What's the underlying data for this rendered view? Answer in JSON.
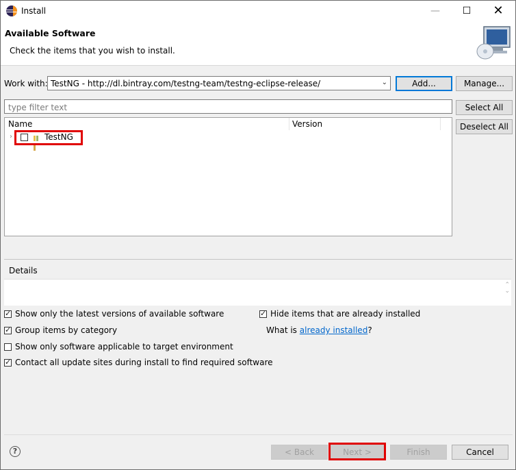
{
  "window": {
    "title": "Install",
    "minimize": "—",
    "maximize": "☐",
    "close": "✕"
  },
  "header": {
    "title": "Available Software",
    "subtitle": "Check the items that you wish to install."
  },
  "work_with": {
    "label": "Work with:",
    "value": "TestNG - http://dl.bintray.com/testng-team/testng-eclipse-release/",
    "add_label": "Add...",
    "manage_label": "Manage..."
  },
  "filter": {
    "placeholder": "type filter text"
  },
  "buttons": {
    "select_all": "Select All",
    "deselect_all": "Deselect All"
  },
  "tree": {
    "columns": [
      "Name",
      "Version"
    ],
    "items": [
      {
        "label": "TestNG",
        "checked": false
      }
    ]
  },
  "details": {
    "label": "Details"
  },
  "options": {
    "latest_versions": {
      "label": "Show only the latest versions of available software",
      "checked": true
    },
    "group_by_category": {
      "label": "Group items by category",
      "checked": true
    },
    "target_env": {
      "label": "Show only software applicable to target environment",
      "checked": false
    },
    "contact_sites": {
      "label": "Contact all update sites during install to find required software",
      "checked": true
    },
    "hide_installed": {
      "label": "Hide items that are already installed",
      "checked": true
    },
    "what_is_prefix": "What is",
    "already_installed_link": "already installed",
    "what_is_suffix": "?"
  },
  "footer": {
    "help": "?",
    "back": "< Back",
    "next": "Next >",
    "finish": "Finish",
    "cancel": "Cancel"
  },
  "colors": {
    "highlight_red": "#e00000",
    "link_blue": "#0066cc",
    "default_button_border": "#0078d7"
  }
}
